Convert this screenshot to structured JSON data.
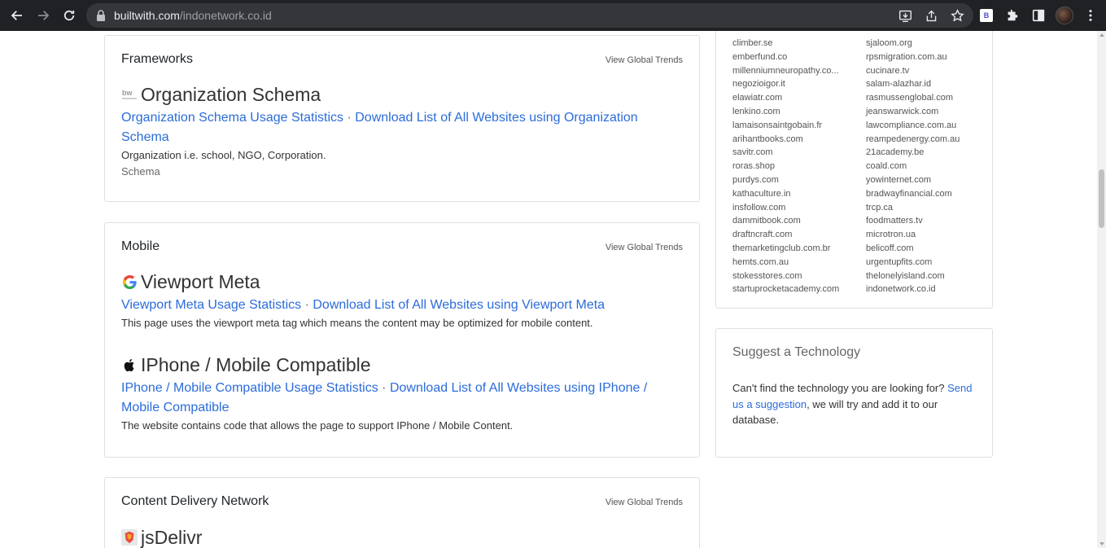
{
  "browser": {
    "url_host": "builtwith.com",
    "url_path": "/indonetwork.co.id",
    "extension_badge": "B"
  },
  "sections": [
    {
      "heading": "Frameworks",
      "trends_label": "View Global Trends",
      "techs": [
        {
          "name": "Organization Schema",
          "icon": "builtwith-icon",
          "usage_link": "Organization Schema Usage Statistics",
          "separator": "·",
          "download_link": "Download List of All Websites using Organization Schema",
          "description": "Organization i.e. school, NGO, Corporation.",
          "tag": "Schema"
        }
      ]
    },
    {
      "heading": "Mobile",
      "trends_label": "View Global Trends",
      "techs": [
        {
          "name": "Viewport Meta",
          "icon": "google-icon",
          "usage_link": "Viewport Meta Usage Statistics",
          "separator": "·",
          "download_link": "Download List of All Websites using Viewport Meta",
          "description": "This page uses the viewport meta tag which means the content may be optimized for mobile content."
        },
        {
          "name": "IPhone / Mobile Compatible",
          "icon": "apple-icon",
          "usage_link": "IPhone / Mobile Compatible Usage Statistics",
          "separator": "·",
          "download_link": "Download List of All Websites using IPhone / Mobile Compatible",
          "description": "The website contains code that allows the page to support IPhone / Mobile Content."
        }
      ]
    },
    {
      "heading": "Content Delivery Network",
      "trends_label": "View Global Trends",
      "techs": [
        {
          "name": "jsDelivr",
          "icon": "jsdelivr-icon"
        }
      ]
    }
  ],
  "related_sites": {
    "left": [
      "climber.se",
      "emberfund.co",
      "millenniumneuropathy.co...",
      "negozioigor.it",
      "elawiatr.com",
      "lenkino.com",
      "lamaisonsaintgobain.fr",
      "arihantbooks.com",
      "savitr.com",
      "roras.shop",
      "purdys.com",
      "kathaculture.in",
      "insfollow.com",
      "dammitbook.com",
      "draftncraft.com",
      "themarketingclub.com.br",
      "hemts.com.au",
      "stokesstores.com",
      "startuprocketacademy.com"
    ],
    "right": [
      "sjaloom.org",
      "rpsmigration.com.au",
      "cucinare.tv",
      "salam-alazhar.id",
      "rasmussenglobal.com",
      "jeanswarwick.com",
      "lawcompliance.com.au",
      "reampedenergy.com.au",
      "21academy.be",
      "coald.com",
      "yowinternet.com",
      "bradwayfinancial.com",
      "trcp.ca",
      "foodmatters.tv",
      "microtron.ua",
      "belicoff.com",
      "urgentupfits.com",
      "thelonelyisland.com",
      "indonetwork.co.id"
    ]
  },
  "suggest": {
    "title": "Suggest a Technology",
    "text_before": "Can't find the technology you are looking for? ",
    "link": "Send us a suggestion",
    "text_after": ", we will try and add it to our database."
  }
}
